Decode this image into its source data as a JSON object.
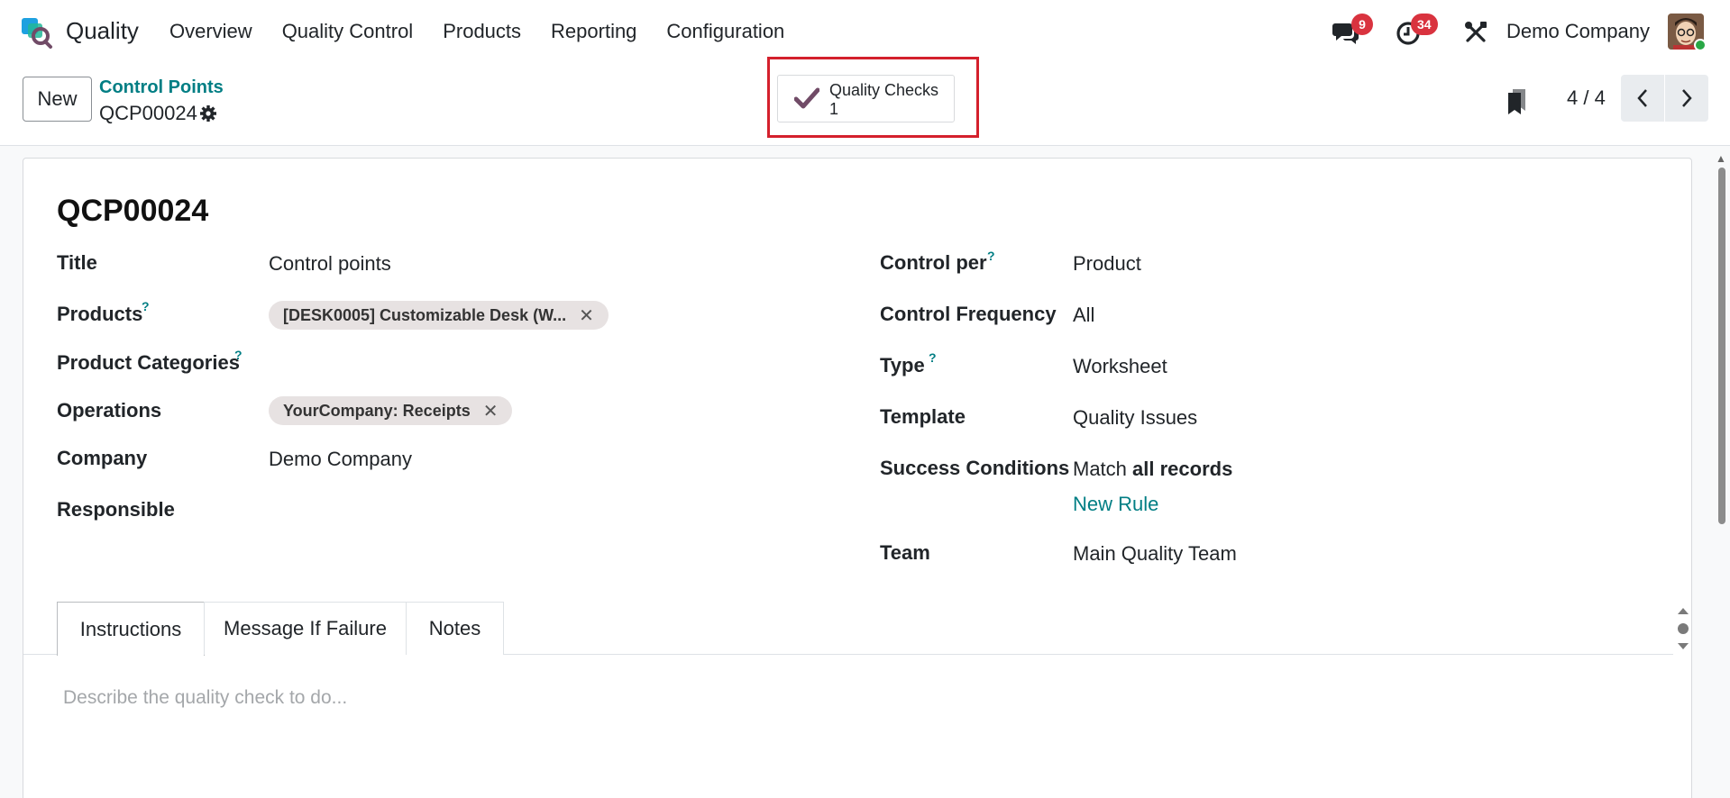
{
  "navbar": {
    "app_name": "Quality",
    "menu": [
      "Overview",
      "Quality Control",
      "Products",
      "Reporting",
      "Configuration"
    ],
    "messages_count": "9",
    "activities_count": "34",
    "company": "Demo Company"
  },
  "control_panel": {
    "new_label": "New",
    "breadcrumb": "Control Points",
    "record_name": "QCP00024",
    "smart_button": {
      "label": "Quality Checks",
      "count": "1"
    },
    "pager": "4 / 4"
  },
  "form": {
    "title": "QCP00024",
    "left": {
      "title_label": "Title",
      "title_value": "Control points",
      "products_label": "Products",
      "products_tag": "[DESK0005] Customizable Desk (W...",
      "categories_label": "Product Categories",
      "operations_label": "Operations",
      "operations_tag": "YourCompany: Receipts",
      "company_label": "Company",
      "company_value": "Demo Company",
      "responsible_label": "Responsible"
    },
    "right": {
      "control_per_label": "Control per",
      "control_per_value": "Product",
      "frequency_label": "Control Frequency",
      "frequency_value": "All",
      "type_label": "Type",
      "type_value": "Worksheet",
      "template_label": "Template",
      "template_value": "Quality Issues",
      "success_label": "Success Conditions",
      "success_prefix": "Match",
      "success_bold": "all records",
      "new_rule": "New Rule",
      "team_label": "Team",
      "team_value": "Main Quality Team"
    },
    "help_mark": "?",
    "tabs": [
      "Instructions",
      "Message If Failure",
      "Notes"
    ],
    "instructions_placeholder": "Describe the quality check to do..."
  },
  "colors": {
    "accent": "#017e84",
    "badge": "#d9333f",
    "highlight": "#d4202c",
    "check": "#714b67"
  }
}
